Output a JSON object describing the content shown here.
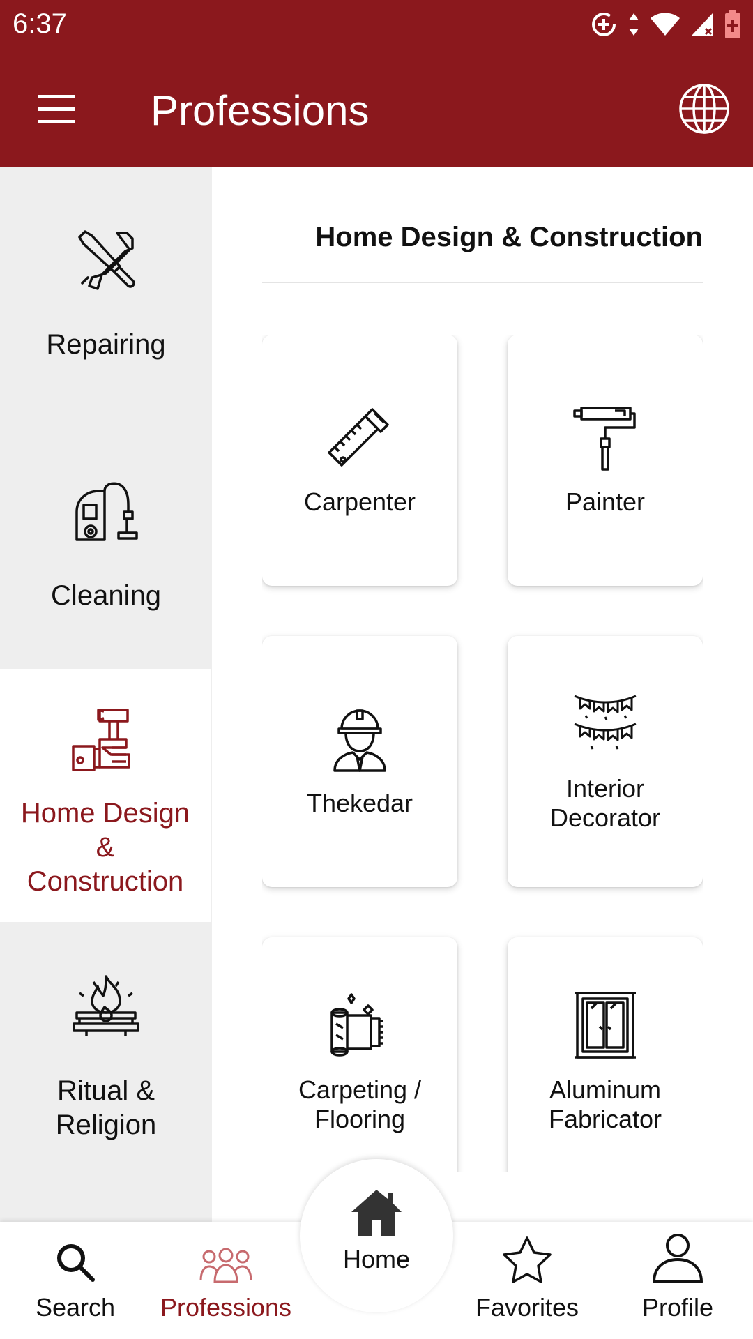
{
  "status_bar": {
    "time": "6:37",
    "icons": [
      "data-saver-icon",
      "data-arrows-icon",
      "wifi-icon",
      "signal-icon",
      "battery-icon"
    ]
  },
  "app_bar": {
    "title": "Professions",
    "menu_icon": "hamburger-menu-icon",
    "action_icon": "globe-icon"
  },
  "colors": {
    "primary": "#8b181d",
    "rail_bg": "#eeeeee",
    "text": "#111111"
  },
  "categories": [
    {
      "label": "Repairing",
      "icon": "tools-icon",
      "active": false
    },
    {
      "label": "Cleaning",
      "icon": "vacuum-cleaner-icon",
      "active": false
    },
    {
      "label": "Home Design & Construction",
      "icon": "hammer-hand-icon",
      "active": true
    },
    {
      "label": "Ritual & Religion",
      "icon": "fire-altar-icon",
      "active": false
    }
  ],
  "section": {
    "title": "Home Design & Construction",
    "professions": [
      {
        "label": "Carpenter",
        "icon": "saw-icon"
      },
      {
        "label": "Painter",
        "icon": "paint-roller-icon"
      },
      {
        "label": "Thekedar",
        "icon": "contractor-icon"
      },
      {
        "label": "Interior Decorator",
        "icon": "bunting-icon"
      },
      {
        "label": "Carpeting / Flooring",
        "icon": "carpet-roll-icon"
      },
      {
        "label": "Aluminum Fabricator",
        "icon": "window-frame-icon"
      }
    ]
  },
  "bottom_nav": {
    "items": [
      {
        "label": "Search",
        "icon": "search-icon",
        "active": false
      },
      {
        "label": "Professions",
        "icon": "people-icon",
        "active": true
      },
      {
        "label": "Home",
        "icon": "home-icon",
        "active": false
      },
      {
        "label": "Favorites",
        "icon": "star-icon",
        "active": false
      },
      {
        "label": "Profile",
        "icon": "profile-icon",
        "active": false
      }
    ]
  }
}
